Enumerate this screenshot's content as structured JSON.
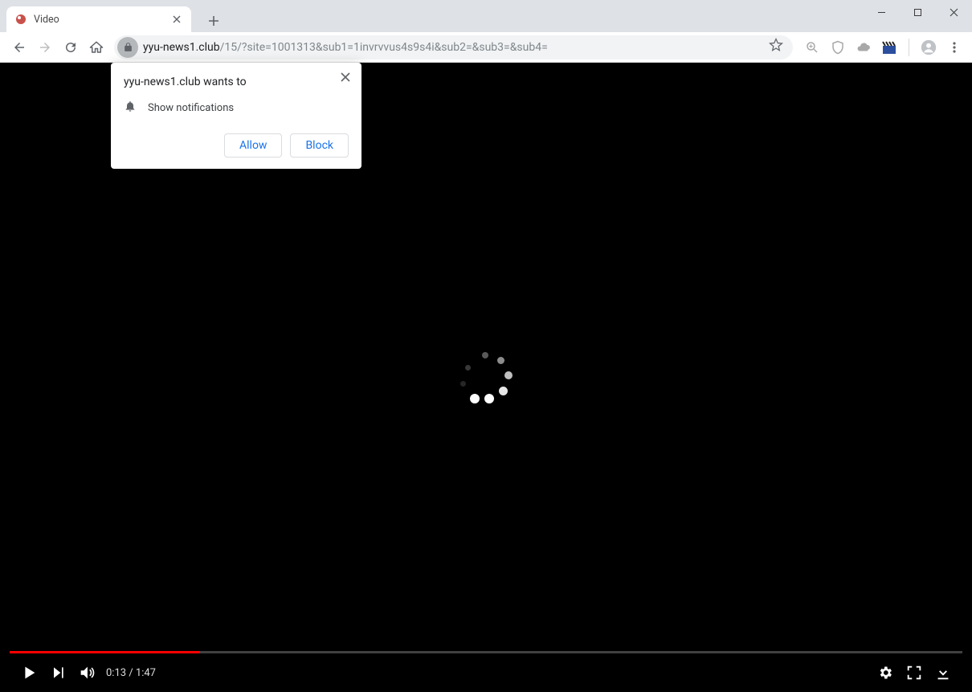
{
  "tab": {
    "title": "Video"
  },
  "address": {
    "host": "yyu-news1.club",
    "path": "/15/?site=1001313&sub1=1invrvvus4s9s4i&sub2=&sub3=&sub4="
  },
  "permission": {
    "title": "yyu-news1.club wants to",
    "request": "Show notifications",
    "allow": "Allow",
    "block": "Block"
  },
  "video": {
    "current_time": "0:13",
    "duration": "1:47",
    "progress_percent": 20
  }
}
